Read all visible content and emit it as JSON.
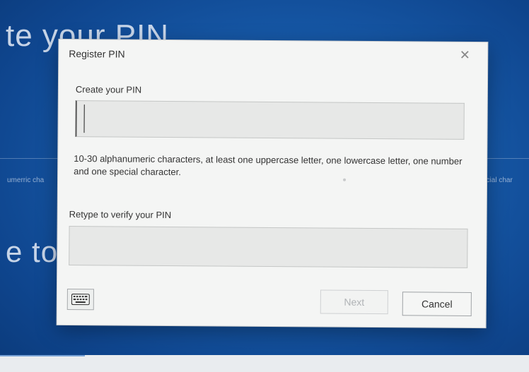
{
  "background": {
    "heading_top": "te your PIN",
    "heading_bottom": "e to",
    "small_left": "umerric cha",
    "small_right": "ecial char"
  },
  "dialog": {
    "title": "Register PIN",
    "close_glyph": "✕",
    "create_label": "Create your PIN",
    "create_value": "",
    "description": "10-30 alphanumeric characters, at least one uppercase letter, one lowercase letter, one number and one special character.",
    "retype_label": "Retype to verify your PIN",
    "retype_value": "",
    "keyboard_icon": "keyboard-icon",
    "next_label": "Next",
    "cancel_label": "Cancel"
  }
}
